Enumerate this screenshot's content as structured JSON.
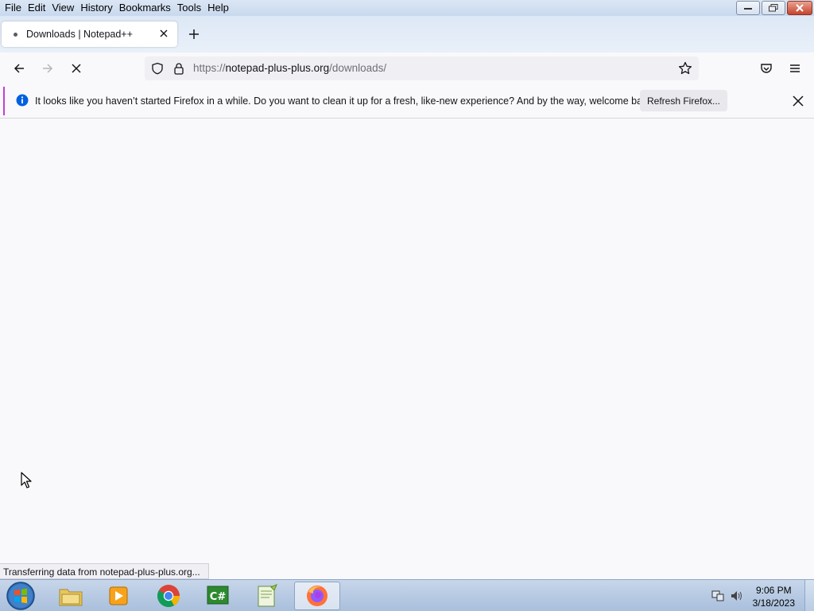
{
  "menubar": {
    "items": [
      {
        "label": "File"
      },
      {
        "label": "Edit"
      },
      {
        "label": "View"
      },
      {
        "label": "History"
      },
      {
        "label": "Bookmarks"
      },
      {
        "label": "Tools"
      },
      {
        "label": "Help"
      }
    ]
  },
  "tab": {
    "title": "Downloads | Notepad++"
  },
  "urlbar": {
    "host_prefix": "https://",
    "host": "notepad-plus-plus.org",
    "path": "/downloads/"
  },
  "notification": {
    "message": "It looks like you haven’t started Firefox in a while. Do you want to clean it up for a fresh, like-new experience? And by the way, welcome back!",
    "button_label": "Refresh Firefox..."
  },
  "status": {
    "text": "Transferring data from notepad-plus-plus.org..."
  },
  "taskbar": {
    "apps": [
      {
        "name": "file-explorer-icon"
      },
      {
        "name": "media-player-icon"
      },
      {
        "name": "chrome-icon"
      },
      {
        "name": "csharp-editor-icon"
      },
      {
        "name": "notepad-plus-plus-icon"
      },
      {
        "name": "firefox-icon"
      }
    ],
    "time": "9:06 PM",
    "date": "3/18/2023"
  },
  "colors": {
    "accent": "#c83cd6",
    "info_blue": "#0060df"
  }
}
